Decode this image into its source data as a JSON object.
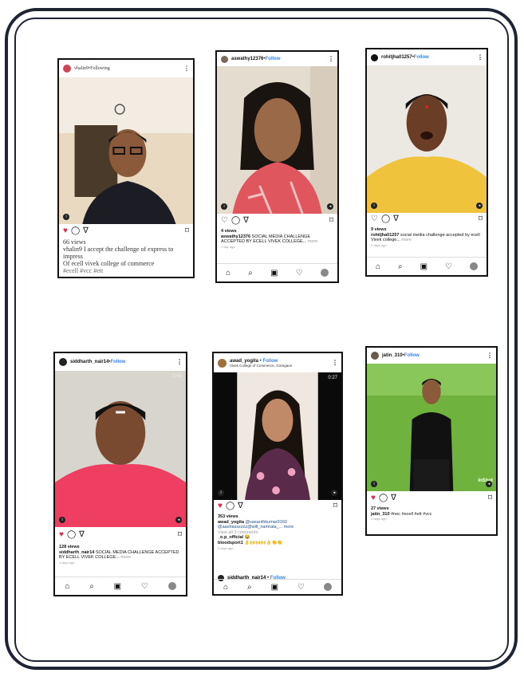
{
  "posts": [
    {
      "username": "vhalin9",
      "dot": " • ",
      "follow_label": "Following",
      "views": "66 views",
      "caption_user": "vhalin9",
      "caption": " I accept the challenge of express to impress",
      "caption_line2": "Of ecell vivek college of commerce",
      "caption_line3": "#ecell #vcc #ett"
    },
    {
      "username": "aswathy12376",
      "dot": " • ",
      "follow_label": "Follow",
      "views": "4 views",
      "caption_user": "aswathy12376",
      "caption": " SOCIAL MEDIA CHALLENGE ACCEPTED BY ECELL VIVEK COLLEGE... ",
      "more": "more",
      "time": "1 day ago"
    },
    {
      "username": "rohitjha01257",
      "dot": " • ",
      "follow_label": "Follow",
      "views": "9 views",
      "caption_user": "rohitjha01257",
      "caption": " social media challenge accepted by ecell Vivek college... ",
      "more": "more",
      "time": "2 days ago"
    },
    {
      "username": "siddharth_nair14",
      "dot": " • ",
      "follow_label": "Follow",
      "video_time": "0:40",
      "views": "128 views",
      "caption_user": "siddharth_nair14",
      "caption": " SOCIAL MEDIA CHALLENGE ACCEPTED BY ECELL VIVEK COLLEGE... ",
      "more": "more",
      "time": "1 days ago"
    },
    {
      "username": "awad_yogita",
      "dot": " • ",
      "follow_label": "Follow",
      "subtitle": "Vivek College of Commerce, Goregaon",
      "video_time": "0:27",
      "views": "353 views",
      "caption_user": "awad_yogita",
      "caption": " @vasanthkumar9160",
      "caption_line2": "@aashasszzzz@will_namrata_... more",
      "view_comments": "View all 3 comments",
      "comment1_user": "_o.p_official",
      "comment1_text": " 😂",
      "comment2_user": "bloodsport1",
      "comment2_text": " 👌🙌🙌🙌👌👏👏",
      "time": "3 days ago",
      "next_username": "siddharth_nair14",
      "next_follow": "Follow"
    },
    {
      "username": "jatin_310",
      "dot": " • ",
      "follow_label": "Follow",
      "watermark": "InShot",
      "views": "27 views",
      "caption_user": "jatin_310",
      "caption": " #nec #ecell #ett #vcc",
      "time": "3 days ago"
    }
  ],
  "icons": {
    "heart": "♡",
    "heart_filled": "♥",
    "comment": "◯",
    "share": "∇",
    "bookmark": "⌑",
    "home": "⌂",
    "search": "⌕",
    "reels": "▣"
  },
  "colors": {
    "like_red": "#e0264a",
    "follow_blue": "#3b82f6",
    "frame": "#1e2433"
  }
}
